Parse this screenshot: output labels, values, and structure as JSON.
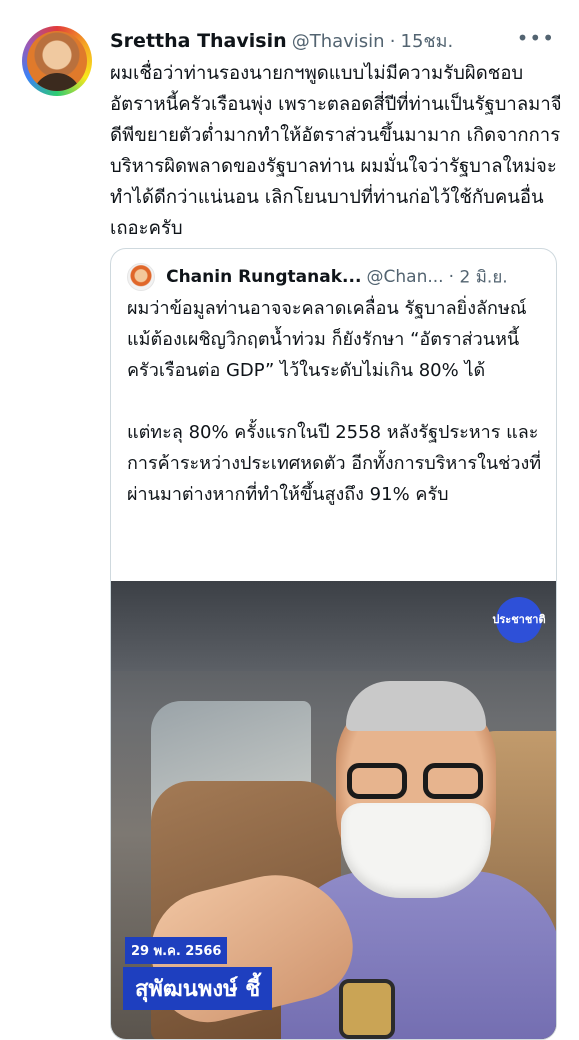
{
  "tweet": {
    "author_name": "Srettha Thavisin",
    "handle": "@Thavisin",
    "time": "15ชม.",
    "more_icon": "more-icon",
    "text": "ผมเชื่อว่าท่านรองนายกฯพูดแบบไม่มีความรับผิดชอบ อัตราหนี้ครัวเรือนพุ่ง เพราะตลอดสี่ปีที่ท่านเป็นรัฐบาลมาจีดีพีขยายตัวต่ำมากทำให้อัตราส่วนขึ้นมามาก เกิดจากการบริหารผิดพลาดของรัฐบาลท่าน ผมมั่นใจว่ารัฐบาลใหม่จะทำได้ดีกว่าแน่นอน เลิกโยนบาปที่ท่านก่อไว้ใช้กับคนอื่นเถอะครับ"
  },
  "quote": {
    "author_name": "Chanin Rungtanak...",
    "handle": "@Chan...",
    "time": "2 มิ.ย.",
    "paragraph1": "ผมว่าข้อมูลท่านอาจจะคลาดเคลื่อน รัฐบาลยิ่งลักษณ์แม้ต้องเผชิญวิกฤตน้ำท่วม ก็ยังรักษา “อัตราส่วนหนี้ครัวเรือนต่อ GDP” ไว้ในระดับไม่เกิน 80% ได้",
    "paragraph2": "แต่ทะลุ 80% ครั้งแรกในปี 2558 หลังรัฐประหาร และการค้าระหว่างประเทศหดตัว อีกทั้งการบริหารในช่วงที่ผ่านมาต่างหากที่ทำให้ขึ้นสูงถึง 91% ครับ",
    "media": {
      "logo_text": "ประชาชาติ",
      "date": "29 พ.ค. 2566",
      "caption": "สุพัฒนพงษ์ ชี้"
    }
  }
}
